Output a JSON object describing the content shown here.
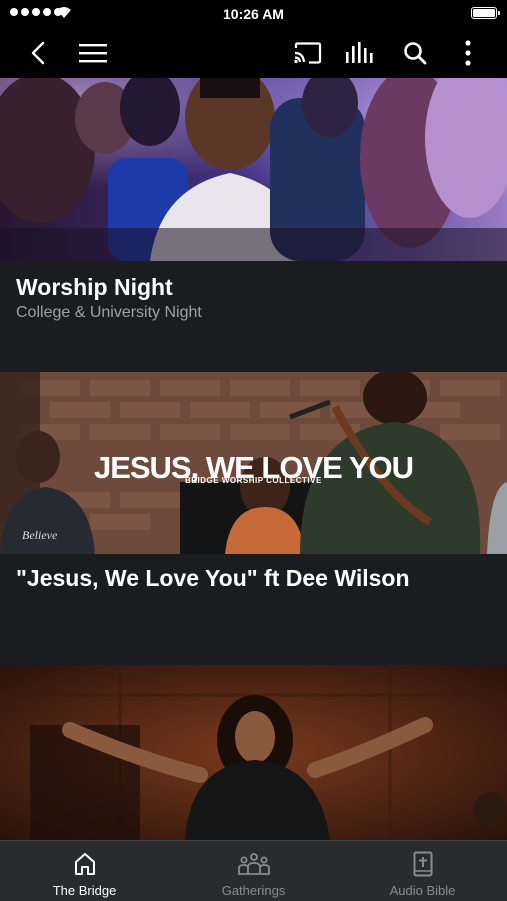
{
  "status_bar": {
    "time": "10:26 AM"
  },
  "nav": {
    "icons": [
      "back-icon",
      "menu-icon",
      "cast-icon",
      "audio-bars-icon",
      "search-icon",
      "more-icon"
    ]
  },
  "feed": {
    "items": [
      {
        "title": "Worship Night",
        "subtitle": "College & University Night"
      },
      {
        "title": "\"Jesus, We Love You\" ft Dee Wilson",
        "overlay_title": "JESUS, WE LOVE YOU",
        "overlay_subtitle": "BRIDGE WORSHIP COLLECTIVE",
        "shirt_text": "Believe"
      },
      {
        "title": ""
      }
    ]
  },
  "tab_bar": {
    "tabs": [
      {
        "label": "The Bridge",
        "icon": "home-icon",
        "active": true
      },
      {
        "label": "Gatherings",
        "icon": "group-icon",
        "active": false
      },
      {
        "label": "Audio Bible",
        "icon": "bible-icon",
        "active": false
      }
    ]
  },
  "colors": {
    "background": "#1b1c1f",
    "bar": "#000000",
    "tab_bar": "#2a2b2e",
    "subtitle": "#9fa1a6"
  }
}
